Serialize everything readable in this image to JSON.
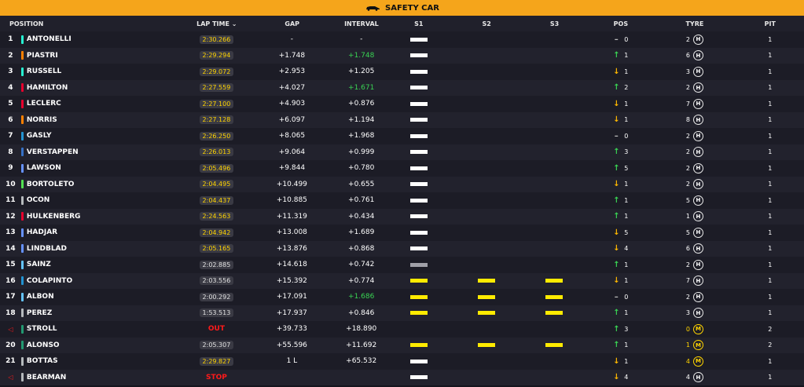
{
  "banner": {
    "label": "SAFETY CAR",
    "icon": "safety-car-icon"
  },
  "columns": {
    "position": "POSITION",
    "lap_time": "LAP TIME",
    "gap": "GAP",
    "interval": "INTERVAL",
    "s1": "S1",
    "s2": "S2",
    "s3": "S3",
    "pos": "POS",
    "tyre": "TYRE",
    "pit": "PIT"
  },
  "colors": {
    "banner": "#f5a51b",
    "improved_interval": "#39d353",
    "out": "#ff1a1a",
    "sector_yellow": "#ffeb00"
  },
  "rows": [
    {
      "pos": "1",
      "name": "ANTONELLI",
      "team": "#27f4d2",
      "lap": "2:30.266",
      "lapc": "y",
      "gap": "-",
      "int": "-",
      "intc": "",
      "s1": "w",
      "s2": "",
      "s3": "",
      "dir": "same",
      "ch": "0",
      "tyren": "2",
      "tyre": "H",
      "pit": "1"
    },
    {
      "pos": "2",
      "name": "PIASTRI",
      "team": "#ff8000",
      "lap": "2:29.294",
      "lapc": "y",
      "gap": "+1.748",
      "int": "+1.748",
      "intc": "up",
      "s1": "w",
      "s2": "",
      "s3": "",
      "dir": "up",
      "ch": "1",
      "tyren": "6",
      "tyre": "H",
      "pit": "1"
    },
    {
      "pos": "3",
      "name": "RUSSELL",
      "team": "#27f4d2",
      "lap": "2:29.072",
      "lapc": "y",
      "gap": "+2.953",
      "int": "+1.205",
      "intc": "",
      "s1": "w",
      "s2": "",
      "s3": "",
      "dir": "down",
      "ch": "1",
      "tyren": "3",
      "tyre": "H",
      "pit": "1"
    },
    {
      "pos": "4",
      "name": "HAMILTON",
      "team": "#e8002d",
      "lap": "2:27.559",
      "lapc": "y",
      "gap": "+4.027",
      "int": "+1.671",
      "intc": "up",
      "s1": "w",
      "s2": "",
      "s3": "",
      "dir": "up",
      "ch": "2",
      "tyren": "2",
      "tyre": "H",
      "pit": "1"
    },
    {
      "pos": "5",
      "name": "LECLERC",
      "team": "#e8002d",
      "lap": "2:27.100",
      "lapc": "y",
      "gap": "+4.903",
      "int": "+0.876",
      "intc": "",
      "s1": "w",
      "s2": "",
      "s3": "",
      "dir": "down",
      "ch": "1",
      "tyren": "7",
      "tyre": "H",
      "pit": "1"
    },
    {
      "pos": "6",
      "name": "NORRIS",
      "team": "#ff8000",
      "lap": "2:27.128",
      "lapc": "y",
      "gap": "+6.097",
      "int": "+1.194",
      "intc": "",
      "s1": "w",
      "s2": "",
      "s3": "",
      "dir": "down",
      "ch": "1",
      "tyren": "8",
      "tyre": "H",
      "pit": "1"
    },
    {
      "pos": "7",
      "name": "GASLY",
      "team": "#2293d1",
      "lap": "2:26.250",
      "lapc": "y",
      "gap": "+8.065",
      "int": "+1.968",
      "intc": "",
      "s1": "w",
      "s2": "",
      "s3": "",
      "dir": "same",
      "ch": "0",
      "tyren": "2",
      "tyre": "H",
      "pit": "1"
    },
    {
      "pos": "8",
      "name": "VERSTAPPEN",
      "team": "#3671c6",
      "lap": "2:26.013",
      "lapc": "y",
      "gap": "+9.064",
      "int": "+0.999",
      "intc": "",
      "s1": "w",
      "s2": "",
      "s3": "",
      "dir": "up",
      "ch": "3",
      "tyren": "2",
      "tyre": "H",
      "pit": "1"
    },
    {
      "pos": "9",
      "name": "LAWSON",
      "team": "#6692ff",
      "lap": "2:05.496",
      "lapc": "y",
      "gap": "+9.844",
      "int": "+0.780",
      "intc": "",
      "s1": "w",
      "s2": "",
      "s3": "",
      "dir": "up",
      "ch": "5",
      "tyren": "2",
      "tyre": "H",
      "pit": "1"
    },
    {
      "pos": "10",
      "name": "BORTOLETO",
      "team": "#52e252",
      "lap": "2:04.495",
      "lapc": "y",
      "gap": "+10.499",
      "int": "+0.655",
      "intc": "",
      "s1": "w",
      "s2": "",
      "s3": "",
      "dir": "down",
      "ch": "1",
      "tyren": "2",
      "tyre": "H",
      "pit": "1"
    },
    {
      "pos": "11",
      "name": "OCON",
      "team": "#b6babd",
      "lap": "2:04.437",
      "lapc": "y",
      "gap": "+10.885",
      "int": "+0.761",
      "intc": "",
      "s1": "w",
      "s2": "",
      "s3": "",
      "dir": "up",
      "ch": "1",
      "tyren": "5",
      "tyre": "H",
      "pit": "1"
    },
    {
      "pos": "12",
      "name": "HULKENBERG",
      "team": "#e8002d",
      "lap": "2:24.563",
      "lapc": "y",
      "gap": "+11.319",
      "int": "+0.434",
      "intc": "",
      "s1": "w",
      "s2": "",
      "s3": "",
      "dir": "up",
      "ch": "1",
      "tyren": "1",
      "tyre": "H",
      "pit": "1"
    },
    {
      "pos": "13",
      "name": "HADJAR",
      "team": "#6692ff",
      "lap": "2:04.942",
      "lapc": "y",
      "gap": "+13.008",
      "int": "+1.689",
      "intc": "",
      "s1": "w",
      "s2": "",
      "s3": "",
      "dir": "down",
      "ch": "5",
      "tyren": "5",
      "tyre": "H",
      "pit": "1"
    },
    {
      "pos": "14",
      "name": "LINDBLAD",
      "team": "#6692ff",
      "lap": "2:05.165",
      "lapc": "y",
      "gap": "+13.876",
      "int": "+0.868",
      "intc": "",
      "s1": "w",
      "s2": "",
      "s3": "",
      "dir": "down",
      "ch": "4",
      "tyren": "6",
      "tyre": "H",
      "pit": "1"
    },
    {
      "pos": "15",
      "name": "SAINZ",
      "team": "#64c4ff",
      "lap": "2:02.885",
      "lapc": "w",
      "gap": "+14.618",
      "int": "+0.742",
      "intc": "",
      "s1": "g",
      "s2": "",
      "s3": "",
      "dir": "up",
      "ch": "1",
      "tyren": "2",
      "tyre": "H",
      "pit": "1"
    },
    {
      "pos": "16",
      "name": "COLAPINTO",
      "team": "#2293d1",
      "lap": "2:03.556",
      "lapc": "w",
      "gap": "+15.392",
      "int": "+0.774",
      "intc": "",
      "s1": "y",
      "s2": "y",
      "s3": "y",
      "dir": "down",
      "ch": "1",
      "tyren": "7",
      "tyre": "H",
      "pit": "1"
    },
    {
      "pos": "17",
      "name": "ALBON",
      "team": "#64c4ff",
      "lap": "2:00.292",
      "lapc": "w",
      "gap": "+17.091",
      "int": "+1.686",
      "intc": "up",
      "s1": "y",
      "s2": "y",
      "s3": "y",
      "dir": "same",
      "ch": "0",
      "tyren": "2",
      "tyre": "H",
      "pit": "1"
    },
    {
      "pos": "18",
      "name": "PEREZ",
      "team": "#b6babd",
      "lap": "1:53.513",
      "lapc": "w",
      "gap": "+17.937",
      "int": "+0.846",
      "intc": "",
      "s1": "y",
      "s2": "y",
      "s3": "y",
      "dir": "up",
      "ch": "1",
      "tyren": "3",
      "tyre": "H",
      "pit": "1"
    },
    {
      "pos": "",
      "name": "STROLL",
      "team": "#229971",
      "lap": "OUT",
      "lapc": "r",
      "gap": "+39.733",
      "int": "+18.890",
      "intc": "",
      "s1": "",
      "s2": "",
      "s3": "",
      "dir": "up",
      "ch": "3",
      "tyren": "0",
      "tyre": "M",
      "pit": "2"
    },
    {
      "pos": "20",
      "name": "ALONSO",
      "team": "#229971",
      "lap": "2:05.307",
      "lapc": "w",
      "gap": "+55.596",
      "int": "+11.692",
      "intc": "",
      "s1": "y",
      "s2": "y",
      "s3": "y",
      "dir": "up",
      "ch": "1",
      "tyren": "1",
      "tyre": "M",
      "pit": "2"
    },
    {
      "pos": "21",
      "name": "BOTTAS",
      "team": "#b6babd",
      "lap": "2:29.827",
      "lapc": "y",
      "gap": "1 L",
      "int": "+65.532",
      "intc": "",
      "s1": "w",
      "s2": "",
      "s3": "",
      "dir": "down",
      "ch": "1",
      "tyren": "4",
      "tyre": "M",
      "pit": "1"
    },
    {
      "pos": "",
      "name": "BEARMAN",
      "team": "#b6babd",
      "lap": "STOP",
      "lapc": "r",
      "gap": "",
      "int": "",
      "intc": "",
      "s1": "w",
      "s2": "",
      "s3": "",
      "dir": "down",
      "ch": "4",
      "tyren": "4",
      "tyre": "H",
      "pit": "1"
    }
  ]
}
